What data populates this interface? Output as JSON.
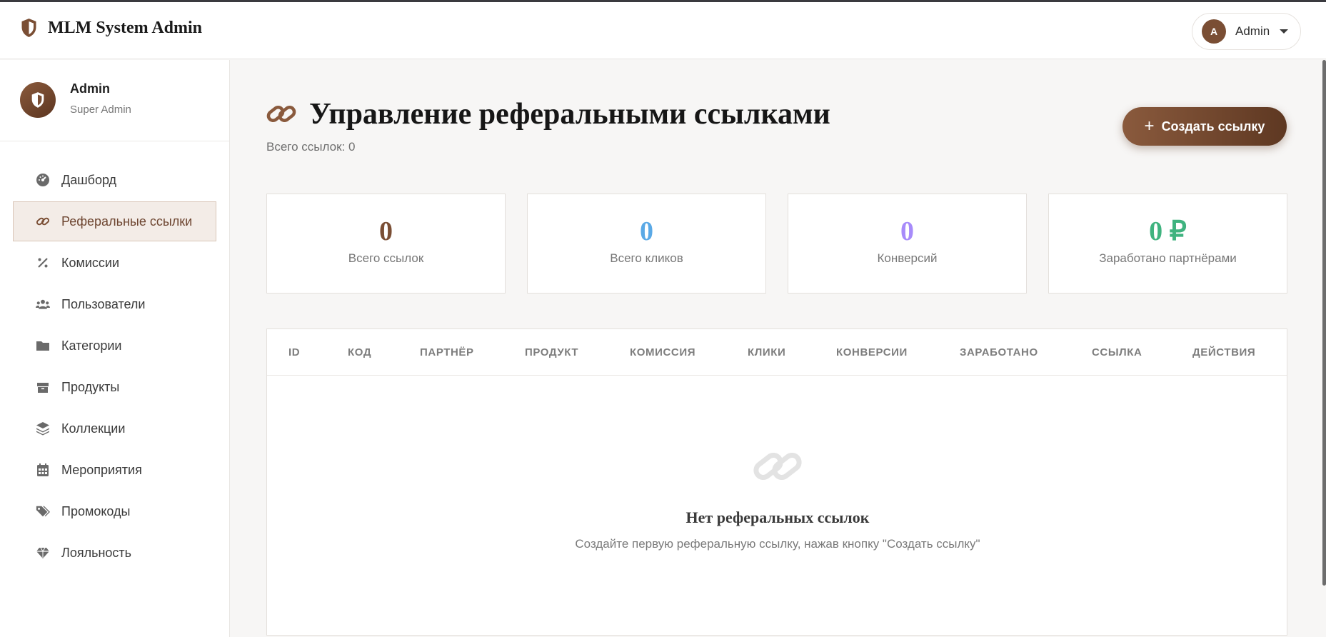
{
  "app": {
    "title": "MLM System Admin"
  },
  "header": {
    "user_initial": "A",
    "user_name": "Admin"
  },
  "sidebar": {
    "profile": {
      "name": "Admin",
      "role": "Super Admin"
    },
    "items": [
      {
        "label": "Дашборд",
        "icon": "gauge-icon"
      },
      {
        "label": "Реферальные ссылки",
        "icon": "link-icon",
        "active": true
      },
      {
        "label": "Комиссии",
        "icon": "percent-icon"
      },
      {
        "label": "Пользователи",
        "icon": "users-icon"
      },
      {
        "label": "Категории",
        "icon": "folder-icon"
      },
      {
        "label": "Продукты",
        "icon": "box-icon"
      },
      {
        "label": "Коллекции",
        "icon": "layers-icon"
      },
      {
        "label": "Мероприятия",
        "icon": "calendar-icon"
      },
      {
        "label": "Промокоды",
        "icon": "tags-icon"
      },
      {
        "label": "Лояльность",
        "icon": "gem-icon"
      }
    ]
  },
  "page": {
    "title": "Управление реферальными ссылками",
    "subtitle": "Всего ссылок: 0",
    "create_button": "Создать ссылку",
    "create_plus": "+"
  },
  "stats": [
    {
      "value": "0",
      "label": "Всего ссылок",
      "color": "#7a4e34"
    },
    {
      "value": "0",
      "label": "Всего кликов",
      "color": "#5aa9e6"
    },
    {
      "value": "0",
      "label": "Конверсий",
      "color": "#a78bfa"
    },
    {
      "value": "0 ₽",
      "label": "Заработано партнёрами",
      "color": "#3fb37f"
    }
  ],
  "table": {
    "columns": [
      "ID",
      "КОД",
      "ПАРТНЁР",
      "ПРОДУКТ",
      "КОМИССИЯ",
      "КЛИКИ",
      "КОНВЕРСИИ",
      "ЗАРАБОТАНО",
      "ССЫЛКА",
      "ДЕЙСТВИЯ"
    ],
    "empty_title": "Нет реферальных ссылок",
    "empty_text": "Создайте первую реферальную ссылку, нажав кнопку \"Создать ссылку\""
  },
  "colors": {
    "accent": "#7a4e34",
    "accent_dark": "#5e3822",
    "active_bg": "#f3ece7"
  }
}
